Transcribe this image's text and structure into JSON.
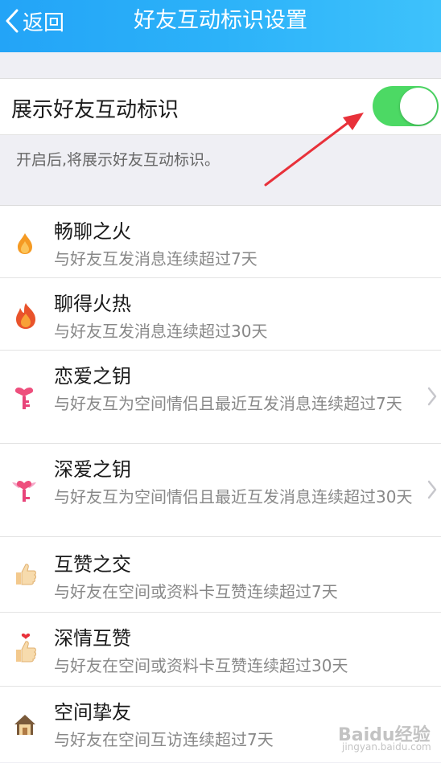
{
  "header": {
    "back_label": "返回",
    "title": "好友互动标识设置"
  },
  "toggle": {
    "label": "展示好友互动标识",
    "state": "on",
    "hint": "开启后,将展示好友互动标识。"
  },
  "colors": {
    "header_gradient": [
      "#23a4f7",
      "#3ec2fb"
    ],
    "switch_on": "#4cd964",
    "arrow": "#e8313a"
  },
  "items": [
    {
      "name": "畅聊之火",
      "desc": "与好友互发消息连续超过7天",
      "icon": "small-flame-icon",
      "chevron": false
    },
    {
      "name": "聊得火热",
      "desc": "与好友互发消息连续超过30天",
      "icon": "big-flame-icon",
      "chevron": false
    },
    {
      "name": "恋爱之钥",
      "desc": "与好友互为空间情侣且最近互发消息连续超过7天",
      "icon": "heart-key-icon",
      "chevron": true
    },
    {
      "name": "深爱之钥",
      "desc": "与好友互为空间情侣且最近互发消息连续超过30天",
      "icon": "winged-heart-key-icon",
      "chevron": true
    },
    {
      "name": "互赞之交",
      "desc": "与好友在空间或资料卡互赞连续超过7天",
      "icon": "thumbs-up-icon",
      "chevron": false
    },
    {
      "name": "深情互赞",
      "desc": "与好友在空间或资料卡互赞连续超过30天",
      "icon": "thumbs-up-heart-icon",
      "chevron": false
    },
    {
      "name": "空间挚友",
      "desc": "与好友在空间互访连续超过7天",
      "icon": "house-icon",
      "chevron": false
    }
  ],
  "watermark": {
    "logo": "Baidu经验",
    "url": "jingyan.baidu.com"
  }
}
